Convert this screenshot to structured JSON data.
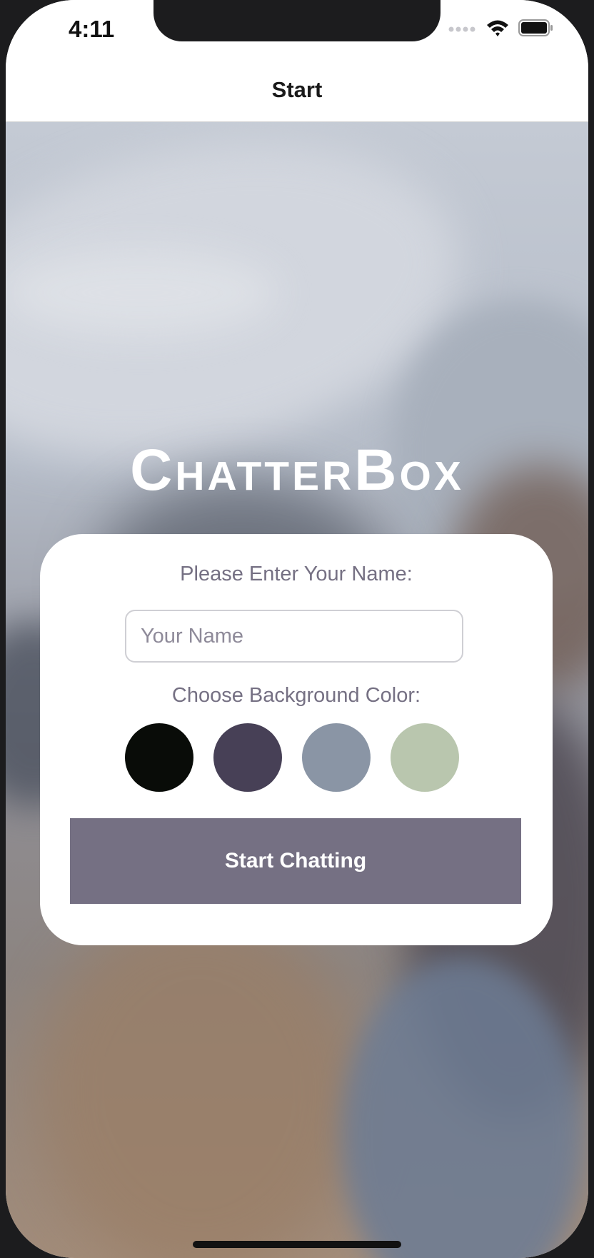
{
  "status_bar": {
    "time": "4:11",
    "icons": [
      "signal-icon",
      "wifi-icon",
      "battery-icon"
    ]
  },
  "nav": {
    "title": "Start"
  },
  "app": {
    "title": "ChatterBox"
  },
  "form": {
    "name_prompt": "Please Enter Your Name:",
    "name_placeholder": "Your Name",
    "name_value": "",
    "color_prompt": "Choose Background Color:",
    "colors": [
      "#090C08",
      "#474056",
      "#8A95A5",
      "#B9C6AE"
    ],
    "start_button": "Start Chatting"
  },
  "theme": {
    "accent": "#757083",
    "text": "#757083"
  }
}
